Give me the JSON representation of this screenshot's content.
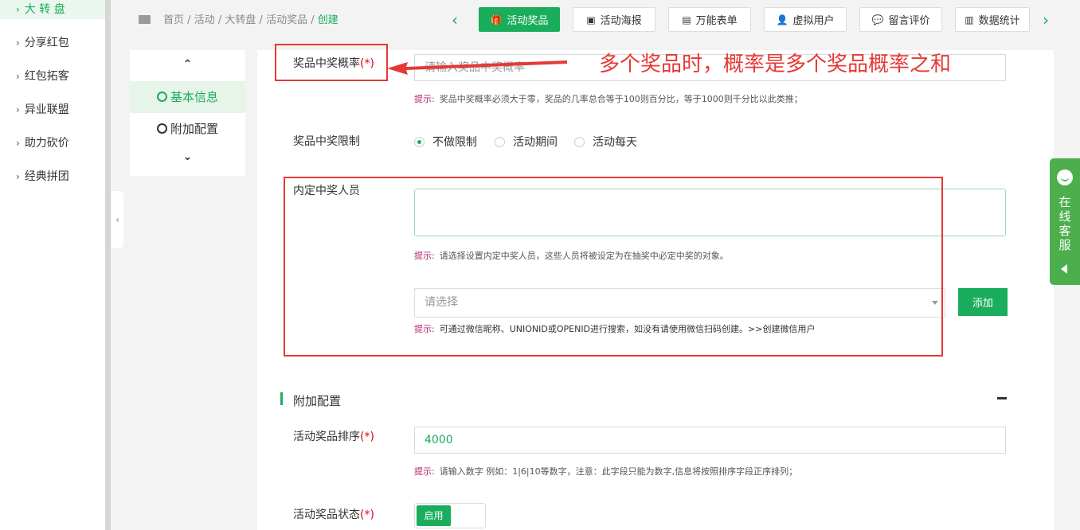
{
  "sidebar": {
    "items": [
      {
        "label": "大 转 盘",
        "active": true
      },
      {
        "label": "分享红包"
      },
      {
        "label": "红包拓客"
      },
      {
        "label": "异业联盟"
      },
      {
        "label": "助力砍价"
      },
      {
        "label": "经典拼团"
      }
    ],
    "chevron": "›",
    "collapse_icon": "‹"
  },
  "breadcrumb": {
    "items": [
      "首页",
      "活动",
      "大转盘",
      "活动奖品"
    ],
    "separator": "/",
    "current": "创建"
  },
  "tabs": {
    "prev": "‹",
    "next": "›",
    "items": [
      {
        "label": "活动奖品",
        "icon": "gift-icon",
        "glyph": "🎁",
        "active": true
      },
      {
        "label": "活动海报",
        "icon": "image-icon",
        "glyph": "▣"
      },
      {
        "label": "万能表单",
        "icon": "file-icon",
        "glyph": "▤"
      },
      {
        "label": "虚拟用户",
        "icon": "add-user-icon",
        "glyph": "👤"
      },
      {
        "label": "留言评价",
        "icon": "comments-icon",
        "glyph": "💬"
      },
      {
        "label": "数据统计",
        "icon": "bar-chart-icon",
        "glyph": "▥"
      }
    ]
  },
  "form_nav": {
    "up": "⌃",
    "down": "⌄",
    "items": [
      {
        "label": "基本信息",
        "active": true
      },
      {
        "label": "附加配置"
      }
    ]
  },
  "form": {
    "win_rate": {
      "label": "奖品中奖概率",
      "required": "(*)",
      "placeholder": "请输入奖品中奖概率",
      "hint_key": "提示:",
      "hint": "奖品中奖概率必须大于零，奖品的几率总合等于100则百分比，等于1000则千分比以此类推；"
    },
    "win_limit": {
      "label": "奖品中奖限制",
      "options": [
        "不做限制",
        "活动期间",
        "活动每天"
      ],
      "selected_index": 0
    },
    "designated": {
      "label": "内定中奖人员",
      "hint_key": "提示:",
      "hint": "请选择设置内定中奖人员，这些人员将被设定为在抽奖中必定中奖的对象。",
      "select_placeholder": "请选择",
      "add_button": "添加",
      "search_hint_key": "提示:",
      "search_hint": "可通过微信昵称、UNIONID或OPENID进行搜索，如没有请使用微信扫码创建。",
      "create_link": ">>创建微信用户"
    }
  },
  "extra": {
    "title": "附加配置",
    "sort": {
      "label": "活动奖品排序",
      "required": "(*)",
      "value": "4000",
      "hint_key": "提示:",
      "hint": "请输入数字 例如：1|6|10等数字，注意：此字段只能为数字,信息将按照排序字段正序排列；"
    },
    "status": {
      "label": "活动奖品状态",
      "required": "(*)",
      "toggle_label": "启用",
      "enabled": true
    }
  },
  "annotation": {
    "text": "多个奖品时，概率是多个奖品概率之和",
    "color": "#e53935"
  },
  "service": {
    "label": "在线客服"
  },
  "colors": {
    "accent": "#1aad5c",
    "required": "#d9001b",
    "hint_key": "#b3246a",
    "service": "#4cae4c"
  }
}
